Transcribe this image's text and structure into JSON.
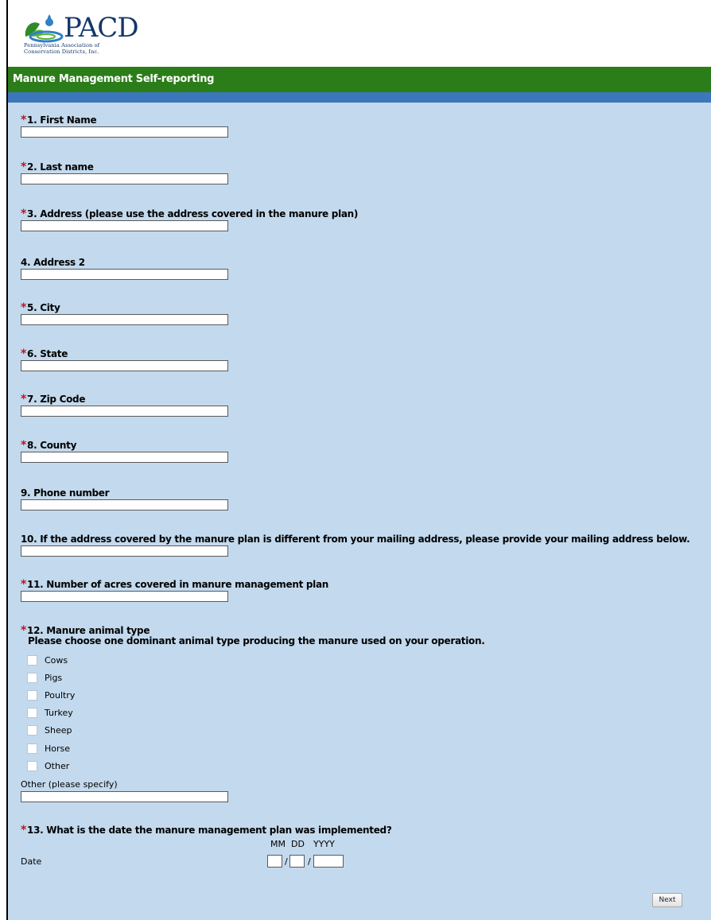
{
  "header": {
    "logo_text": "PACD",
    "logo_subtitle_line1": "Pennsylvania Association of",
    "logo_subtitle_line2": "Conservation Districts, Inc.",
    "form_title": "Manure Management Self-reporting"
  },
  "questions": [
    {
      "required": true,
      "label": "1. First Name",
      "value": ""
    },
    {
      "required": true,
      "label": "2. Last name",
      "value": ""
    },
    {
      "required": true,
      "label": "3. Address (please use the address covered in the manure plan)",
      "value": ""
    },
    {
      "required": false,
      "label": "4. Address 2",
      "value": ""
    },
    {
      "required": true,
      "label": "5. City",
      "value": ""
    },
    {
      "required": true,
      "label": "6. State",
      "value": ""
    },
    {
      "required": true,
      "label": "7. Zip Code",
      "value": ""
    },
    {
      "required": true,
      "label": "8. County",
      "value": ""
    },
    {
      "required": false,
      "label": "9. Phone number",
      "value": ""
    },
    {
      "required": false,
      "label": "10. If the address covered by the manure plan is different from your mailing address, please provide your mailing address below.",
      "value": ""
    },
    {
      "required": true,
      "label": "11. Number of acres covered in manure management plan",
      "value": ""
    }
  ],
  "q12": {
    "required": true,
    "label": "12. Manure animal type",
    "sublabel": "Please choose one dominant animal type producing the manure used on your operation.",
    "options": [
      {
        "label": "Cows",
        "checked": false
      },
      {
        "label": "Pigs",
        "checked": false
      },
      {
        "label": "Poultry",
        "checked": false
      },
      {
        "label": "Turkey",
        "checked": false
      },
      {
        "label": "Sheep",
        "checked": false
      },
      {
        "label": "Horse",
        "checked": false
      },
      {
        "label": "Other",
        "checked": false
      }
    ],
    "other_label": "Other (please specify)",
    "other_value": ""
  },
  "q13": {
    "required": true,
    "label": "13. What is the date the manure management plan was implemented?",
    "row_label": "Date",
    "mm_label": "MM",
    "dd_label": "DD",
    "yyyy_label": "YYYY",
    "separator": "/",
    "mm_value": "",
    "dd_value": "",
    "yyyy_value": ""
  },
  "next_button_label": "Next",
  "colors": {
    "page_background": "#c3d9ed",
    "title_bar": "#2b7d19",
    "accent_strip": "#3c77bb",
    "required_star": "#c0141e",
    "logo_text": "#14376b"
  }
}
